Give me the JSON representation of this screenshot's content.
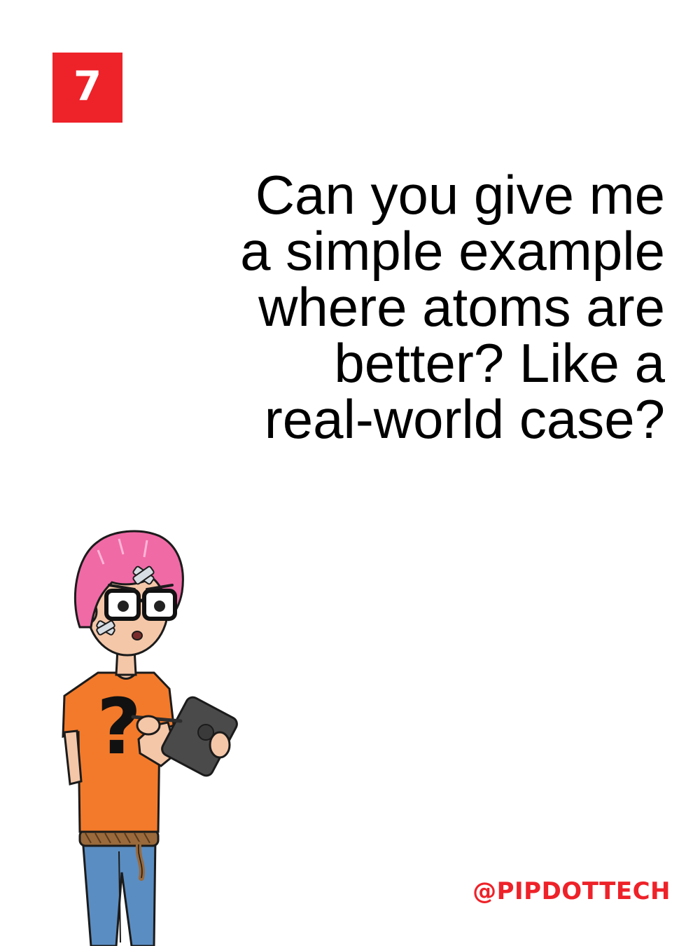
{
  "slide": {
    "number": "7",
    "question_lines": [
      "Can you give me",
      "a simple example",
      "where atoms are",
      "better? Like a",
      "real-world case?"
    ],
    "handle": "@PIPDOTTECH"
  },
  "colors": {
    "accent": "#ee2229",
    "text": "#000000",
    "background": "#ffffff",
    "hair": "#f06aa6",
    "shirt": "#f37a2a",
    "jeans": "#5a8dc2",
    "tablet": "#4a4a4a"
  },
  "illustration": {
    "subject": "person-holding-tablet",
    "shirt_symbol": "?"
  }
}
